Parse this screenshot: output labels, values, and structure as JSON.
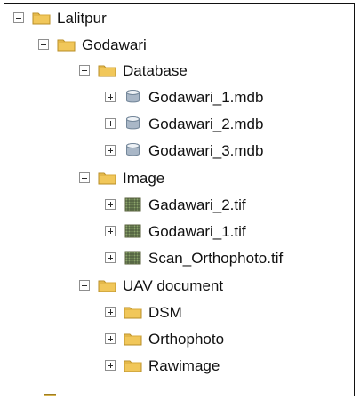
{
  "tree": {
    "root": {
      "label": "Lalitpur",
      "icon": "folder-icon",
      "state": "expanded"
    },
    "godawari": {
      "label": "Godawari",
      "icon": "folder-icon",
      "state": "expanded"
    },
    "database": {
      "label": "Database",
      "icon": "folder-icon",
      "state": "expanded",
      "items": [
        {
          "label": "Godawari_1.mdb",
          "icon": "database-icon",
          "state": "collapsed"
        },
        {
          "label": "Godawari_2.mdb",
          "icon": "database-icon",
          "state": "collapsed"
        },
        {
          "label": "Godawari_3.mdb",
          "icon": "database-icon",
          "state": "collapsed"
        }
      ]
    },
    "image": {
      "label": "Image",
      "icon": "folder-icon",
      "state": "expanded",
      "items": [
        {
          "label": "Gadawari_2.tif",
          "icon": "raster-icon",
          "state": "collapsed"
        },
        {
          "label": "Godawari_1.tif",
          "icon": "raster-icon",
          "state": "collapsed"
        },
        {
          "label": "Scan_Orthophoto.tif",
          "icon": "raster-icon",
          "state": "collapsed"
        }
      ]
    },
    "uav": {
      "label": "UAV document",
      "icon": "folder-icon",
      "state": "expanded",
      "items": [
        {
          "label": "DSM",
          "icon": "folder-icon",
          "state": "collapsed"
        },
        {
          "label": "Orthophoto",
          "icon": "folder-icon",
          "state": "collapsed"
        },
        {
          "label": "Rawimage",
          "icon": "folder-icon",
          "state": "collapsed"
        }
      ]
    }
  },
  "colors": {
    "folder_fill": "#f1c75a",
    "folder_border": "#b88d26",
    "database_fill": "#a9b7c7",
    "raster_fill": "#8aa36a",
    "text": "#111111"
  }
}
